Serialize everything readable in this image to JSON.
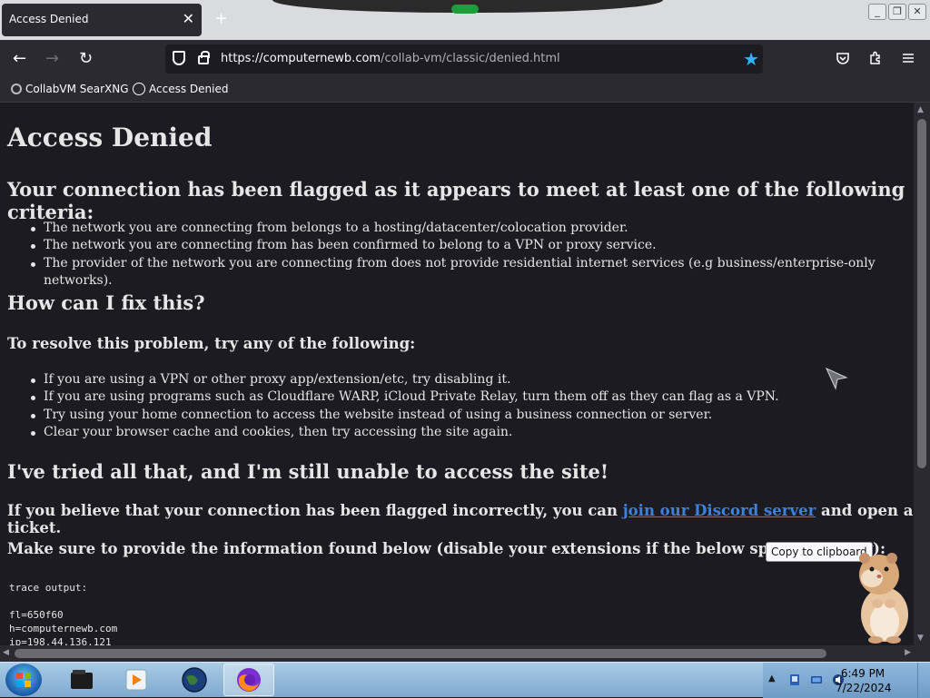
{
  "browser": {
    "tab_title": "Access Denied",
    "tab_close": "✕",
    "new_tab": "+",
    "url_host": "https://computernewb.com",
    "url_path": "/collab-vm/classic/denied.html",
    "bookmarks": [
      {
        "label": "CollabVM SearXNG"
      },
      {
        "label": "Access Denied"
      }
    ]
  },
  "page": {
    "title": "Access Denied",
    "criteria_heading": "Your connection has been flagged as it appears to meet at least one of the following criteria:",
    "criteria": [
      "The network you are connecting from belongs to a hosting/datacenter/colocation provider.",
      "The network you are connecting from has been confirmed to belong to a VPN or proxy service.",
      "The provider of the network you are connecting from does not provide residential internet services (e.g business/enterprise-only networks)."
    ],
    "fix_heading": "How can I fix this?",
    "resolve_heading": "To resolve this problem, try any of the following:",
    "fixes": [
      "If you are using a VPN or other proxy app/extension/etc, try disabling it.",
      "If you are using programs such as Cloudflare WARP, iCloud Private Relay, turn them off as they can flag as a VPN.",
      "Try using your home connection to access the website instead of using a business connection or server.",
      "Clear your browser cache and cookies, then try accessing the site again."
    ],
    "still_heading": "I've tried all that, and I'm still unable to access the site!",
    "discord_before": "If you believe that your connection has been flagged incorrectly, you can ",
    "discord_link": "join our Discord server",
    "discord_after": " and open a ticket.",
    "info_text": "Make sure to provide the information found below (disable your extensions if the below space is empty):",
    "copy_button": "Copy to clipboard",
    "trace": "trace output:\n\nfl=650f60\nh=computernewb.com\nip=198.44.136.121"
  },
  "taskbar": {
    "time": "6:49 PM",
    "date": "7/22/2024"
  },
  "colors": {
    "page_bg": "#1c1b22",
    "link": "#3d82d8",
    "star": "#31b4ff"
  }
}
